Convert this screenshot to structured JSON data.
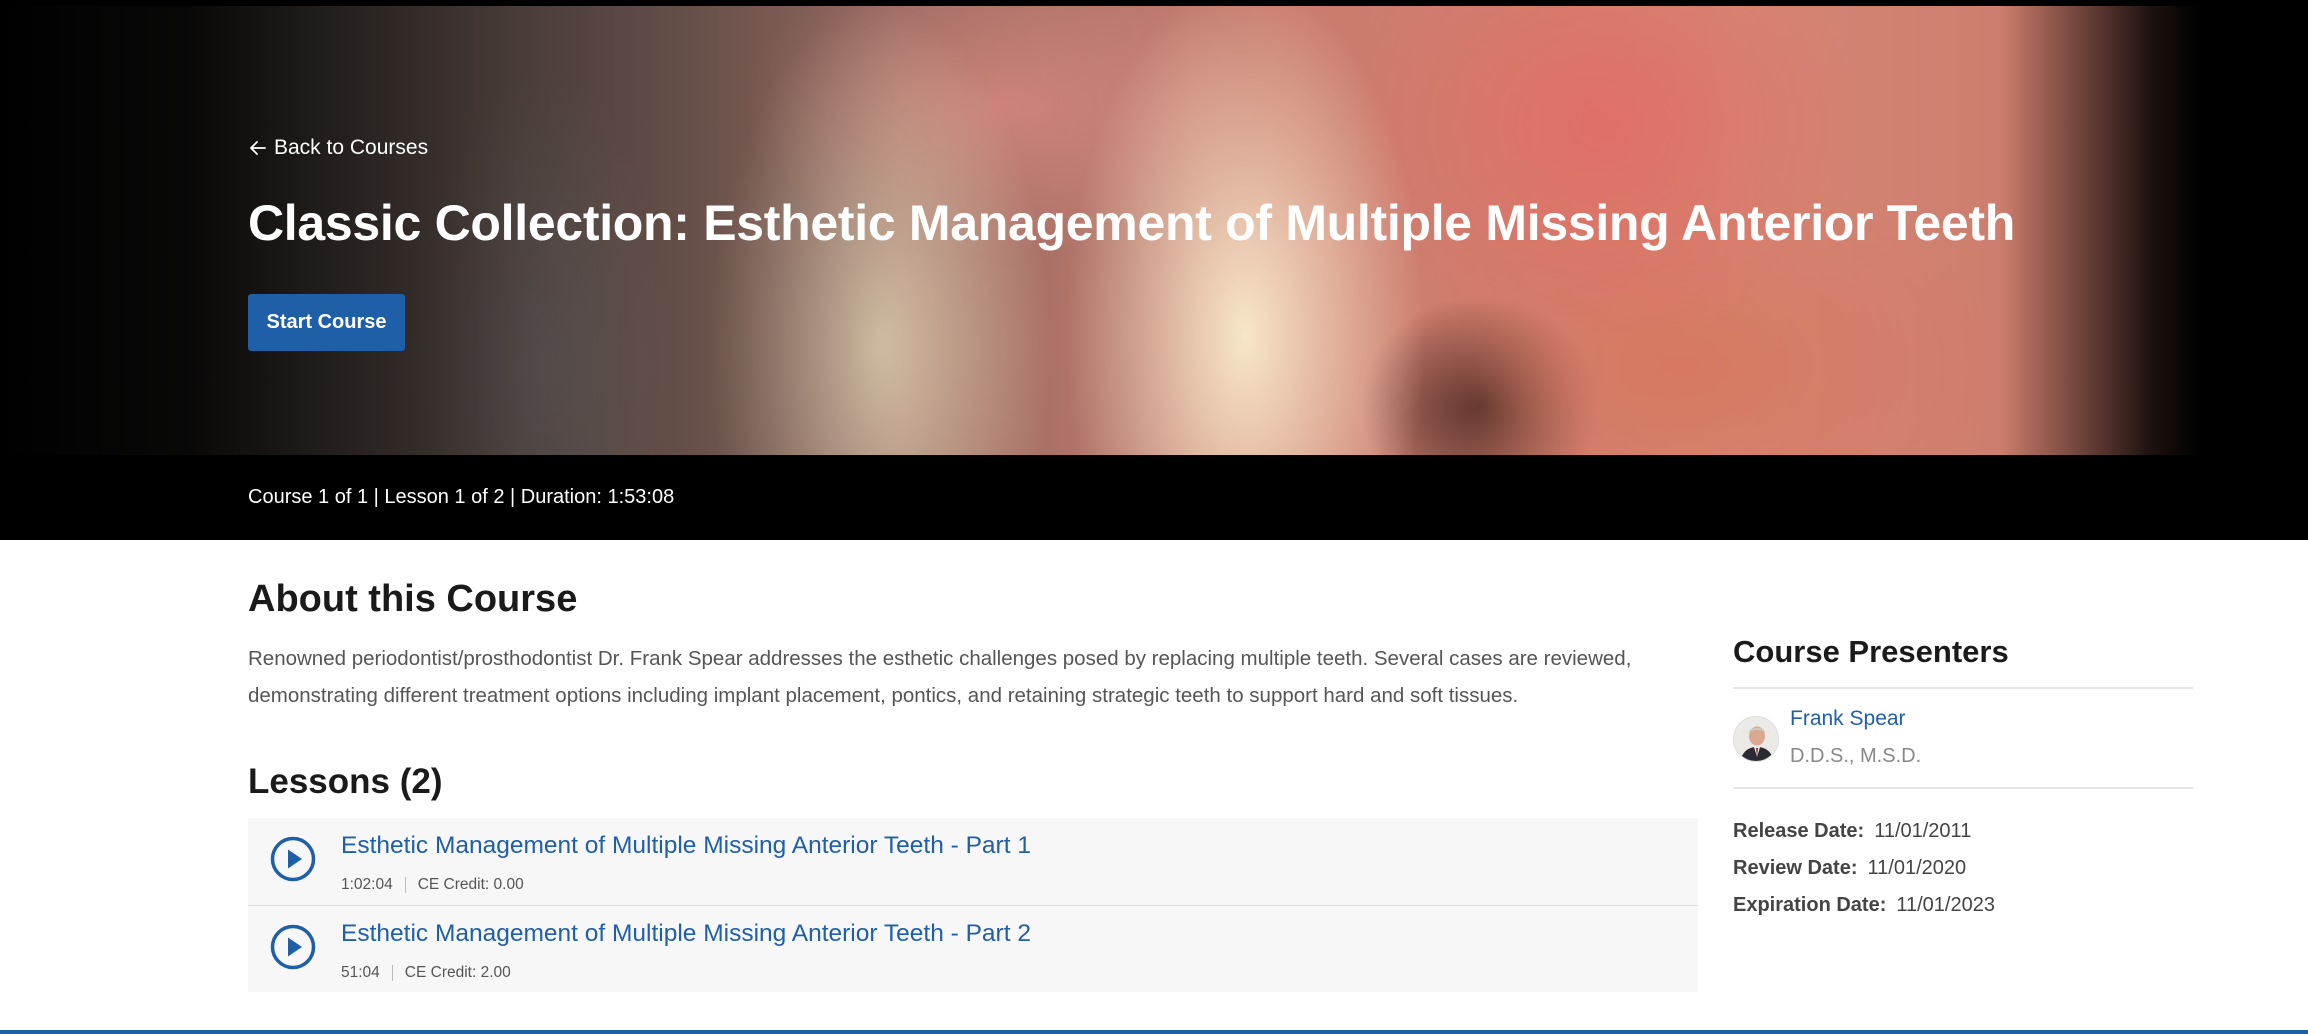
{
  "hero": {
    "back_label": "Back to Courses",
    "title": "Classic Collection: Esthetic Management of Multiple Missing Anterior Teeth",
    "start_button": "Start Course",
    "meta": "Course 1 of 1 | Lesson 1 of 2 | Duration: 1:53:08"
  },
  "about": {
    "heading": "About this Course",
    "description": "Renowned periodontist/prosthodontist Dr. Frank Spear addresses the esthetic challenges posed by replacing multiple teeth. Several cases are reviewed, demonstrating different treatment options including implant placement, pontics, and retaining strategic teeth to support hard and soft tissues."
  },
  "lessons": {
    "heading": "Lessons (2)",
    "items": [
      {
        "title": "Esthetic Management of Multiple Missing Anterior Teeth - Part 1",
        "duration": "1:02:04",
        "credit": "CE Credit: 0.00"
      },
      {
        "title": "Esthetic Management of Multiple Missing Anterior Teeth - Part 2",
        "duration": "51:04",
        "credit": "CE Credit: 2.00"
      }
    ]
  },
  "presenters": {
    "heading": "Course Presenters",
    "name": "Frank Spear",
    "credentials": "D.D.S., M.S.D."
  },
  "dates": {
    "release_label": "Release Date:",
    "release_value": "11/01/2011",
    "review_label": "Review Date:",
    "review_value": "11/01/2020",
    "expiration_label": "Expiration Date:",
    "expiration_value": "11/01/2023"
  },
  "colors": {
    "accent": "#1f5fa8",
    "hero_bg": "#000000"
  }
}
